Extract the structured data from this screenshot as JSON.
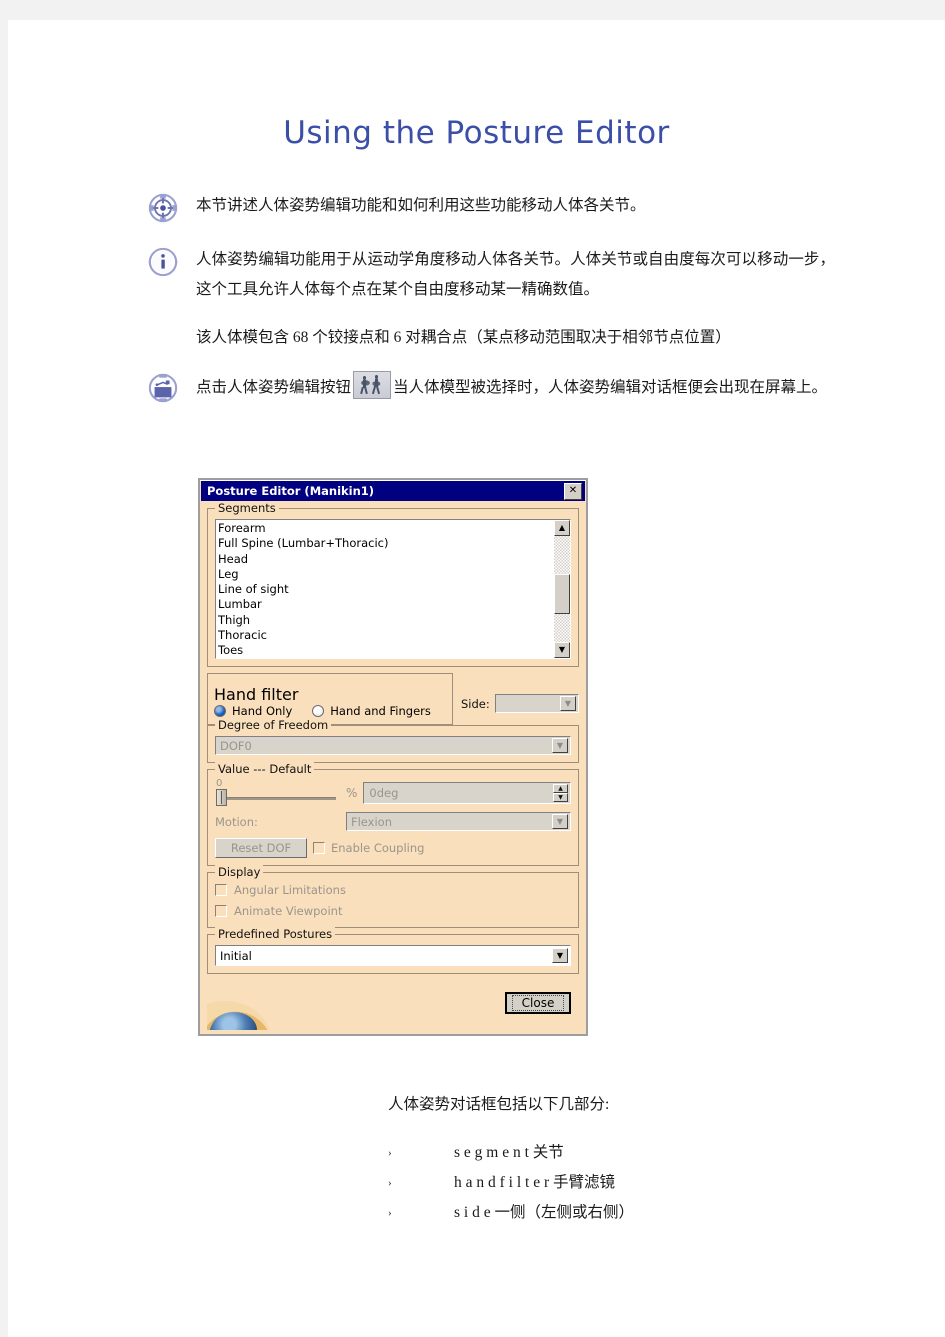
{
  "document": {
    "title": "Using the Posture Editor",
    "paragraphs": [
      {
        "icon": "target-icon",
        "text": "本节讲述人体姿势编辑功能和如何利用这些功能移动人体各关节。"
      },
      {
        "icon": "info-icon",
        "text": "人体姿势编辑功能用于从运动学角度移动人体各关节。人体关节或自由度每次可以移动一步，这个工具允许人体每个点在某个自由度移动某一精确数值。"
      },
      {
        "icon": "none",
        "text": "该人体模包含 68 个铰接点和 6 对耦合点（某点移动范围取决于相邻节点位置）"
      }
    ],
    "step_paragraph": {
      "icon": "procedure-icon",
      "text_before": "点击人体姿势编辑按钮",
      "inline_icon": "manikin-button-icon",
      "text_after": "当人体模型被选择时，人体姿势编辑对话框便会出现在屏幕上。"
    },
    "tail_intro": "人体姿势对话框包括以下几部分:",
    "bullets": [
      {
        "marker": "›",
        "text": "s e g m e n t 关节"
      },
      {
        "marker": "›",
        "text": "h a n d   f i l t e r 手臂滤镜"
      },
      {
        "marker": "›",
        "text": "s i d e   一侧（左侧或右侧）"
      }
    ]
  },
  "dialog": {
    "title": "Posture Editor (Manikin1)",
    "close_glyph": "✕",
    "segments": {
      "group_label": "Segments",
      "items": [
        "Forearm",
        "Full Spine (Lumbar+Thoracic)",
        "Head",
        "Leg",
        "Line of sight",
        "Lumbar",
        "Thigh",
        "Thoracic",
        "Toes"
      ],
      "scroll_up_glyph": "▲",
      "scroll_down_glyph": "▼"
    },
    "hand_filter": {
      "group_label": "Hand filter",
      "option_selected": "Hand Only",
      "option_other": "Hand and Fingers",
      "side_label": "Side:",
      "side_value": "",
      "dropdown_glyph": "▼"
    },
    "degree_of_freedom": {
      "group_label": "Degree of Freedom",
      "value": "DOF0",
      "dropdown_glyph": "▼"
    },
    "value": {
      "group_label": "Value --- Default",
      "slider_value": "0",
      "percent_label": "%",
      "spin_value": "0deg",
      "spin_up_glyph": "▲",
      "spin_down_glyph": "▼",
      "motion_label": "Motion:",
      "motion_value": "Flexion",
      "motion_dropdown_glyph": "▼",
      "reset_button": "Reset DOF",
      "coupling_checkbox": "Enable Coupling"
    },
    "display": {
      "group_label": "Display",
      "options": [
        "Angular Limitations",
        "Animate Viewpoint"
      ]
    },
    "predefined": {
      "group_label": "Predefined Postures",
      "value": "Initial",
      "dropdown_glyph": "▼"
    },
    "footer": {
      "close_button": "Close"
    }
  },
  "colors": {
    "title": "#3b4fa8",
    "titlebar": "#000080",
    "dialog_face": "#fadfbd",
    "page": "#ffffff"
  }
}
